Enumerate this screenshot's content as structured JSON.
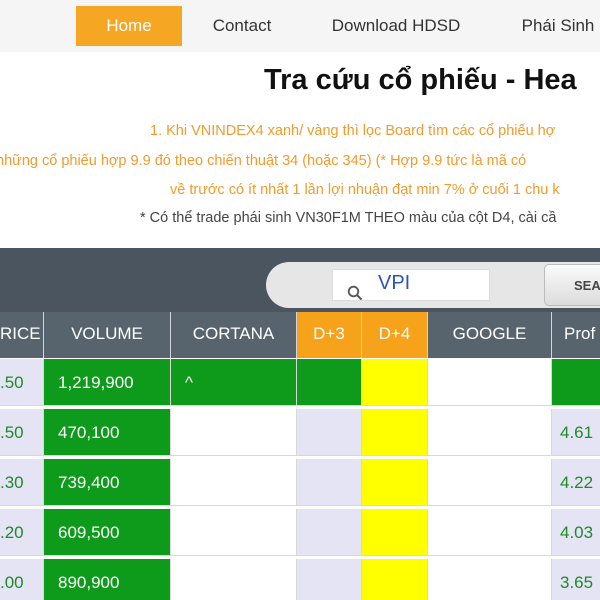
{
  "nav": {
    "items": [
      {
        "label": "Home",
        "active": true
      },
      {
        "label": "Contact"
      },
      {
        "label": "Download HDSD"
      },
      {
        "label": "Phái Sinh"
      }
    ]
  },
  "header": {
    "title": "Tra cứu cổ phiếu - Hea",
    "note1": "1. Khi VNINDEX4 xanh/ vàng thì lọc Board tìm các cổ phiếu hợ",
    "note2": "những cổ phiếu hợp 9.9 đó theo chiến thuật 34 (hoặc 345) (* Hợp 9.9 tức là mã có",
    "note3": "về trước có ít nhất 1 lần lợi nhuận đạt min 7% ở cuối 1 chu k",
    "note4": "* Có thể trade phái sinh VN30F1M THEO màu của cột D4, cài cầ"
  },
  "search": {
    "value": "VPI",
    "button_label": "SEA"
  },
  "table": {
    "headers": [
      "RICE",
      "VOLUME",
      "CORTANA",
      "D+3",
      "D+4",
      "GOOGLE",
      "Prof"
    ],
    "rows": [
      {
        "price": ".50",
        "volume": "1,219,900",
        "cortana": "^",
        "profit": ""
      },
      {
        "price": ".50",
        "volume": "470,100",
        "cortana": "",
        "profit": "4.61"
      },
      {
        "price": ".30",
        "volume": "739,400",
        "cortana": "",
        "profit": "4.22"
      },
      {
        "price": ".20",
        "volume": "609,500",
        "cortana": "",
        "profit": "4.03"
      },
      {
        "price": ".00",
        "volume": "890,900",
        "cortana": "",
        "profit": "3.65"
      }
    ]
  },
  "colors": {
    "accent": "#f5a623",
    "header_dark": "#57646e",
    "green": "#0e9a1b",
    "yellow": "#ffff00",
    "lavender": "#e4e4f5"
  }
}
